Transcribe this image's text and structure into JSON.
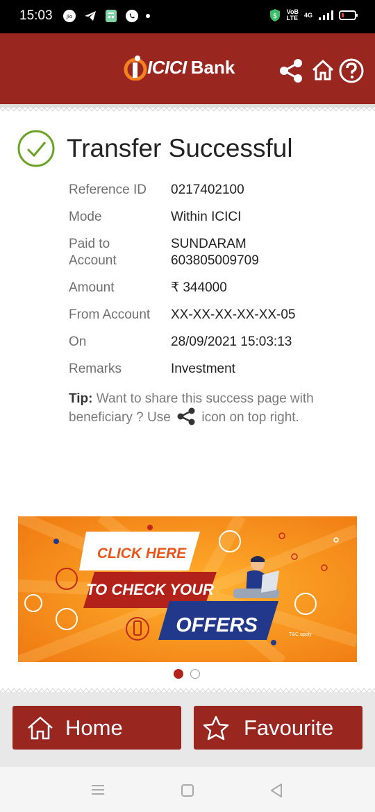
{
  "status_bar": {
    "time": "15:03",
    "right_small_top": "VoB",
    "right_small_bottom": "LTE",
    "network": "4G"
  },
  "header": {
    "logo_text": "ICICI",
    "logo_bank": "Bank",
    "brand_color": "#9a2620",
    "icons": [
      "share-icon",
      "home-icon",
      "help-icon"
    ]
  },
  "transfer": {
    "title": "Transfer Successful",
    "rows": [
      {
        "label": "Reference ID",
        "value": "0217402100"
      },
      {
        "label": "Mode",
        "value": "Within ICICI"
      },
      {
        "label": "Paid to Account",
        "value": "SUNDARAM 603805009709"
      },
      {
        "label": "Amount",
        "value": "₹ 344000"
      },
      {
        "label": "From Account",
        "value": "XX-XX-XX-XX-XX-05"
      },
      {
        "label": "On",
        "value": "28/09/2021 15:03:13"
      },
      {
        "label": "Remarks",
        "value": "Investment"
      }
    ],
    "paid_to_label_1": "Paid to",
    "paid_to_label_2": "Account",
    "paid_to_value_1": "SUNDARAM",
    "paid_to_value_2": "603805009709"
  },
  "tip": {
    "label": "Tip:",
    "text_before": "Want to share this success page with beneficiary ? Use",
    "text_after": "icon on top right."
  },
  "banner": {
    "line1": "CLICK HERE",
    "line2": "TO CHECK YOUR",
    "line3": "OFFERS",
    "tnc": "T&C apply",
    "slide_count": 2,
    "active_slide": 1
  },
  "footer": {
    "home_label": "Home",
    "favourite_label": "Favourite"
  }
}
